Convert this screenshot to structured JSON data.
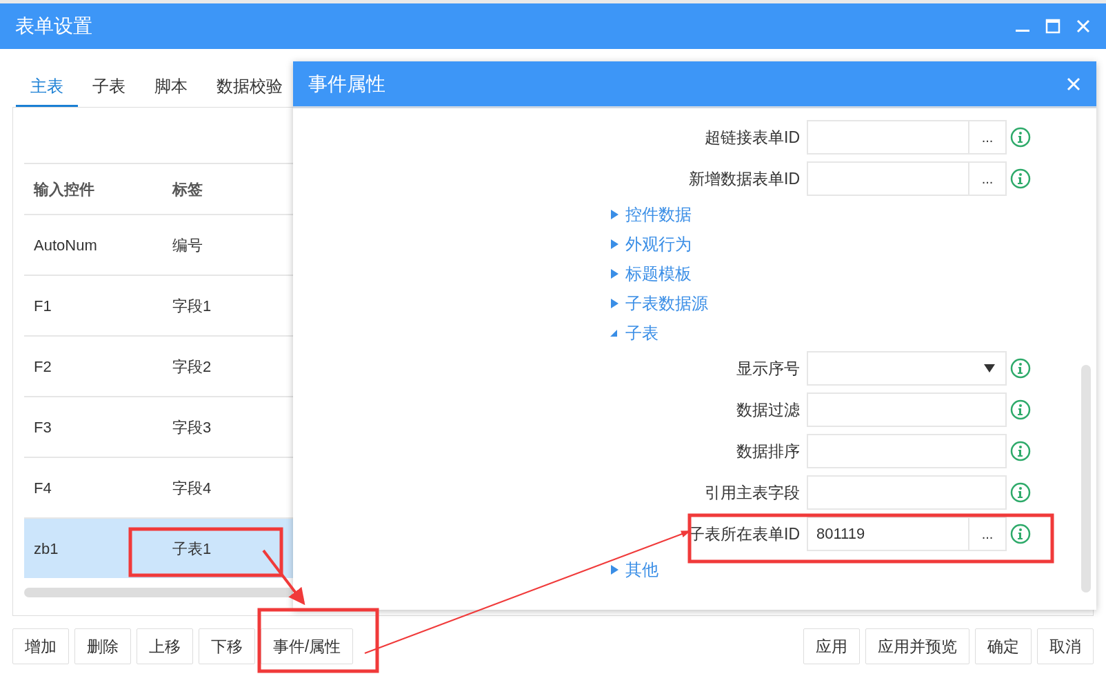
{
  "window": {
    "title": "表单设置"
  },
  "tabs": [
    {
      "label": "主表",
      "selected": true
    },
    {
      "label": "子表",
      "selected": false
    },
    {
      "label": "脚本",
      "selected": false
    },
    {
      "label": "数据校验",
      "selected": false
    }
  ],
  "table": {
    "columns": [
      "输入控件",
      "标签"
    ],
    "rows": [
      {
        "cells": [
          "AutoNum",
          "编号"
        ],
        "selected": false
      },
      {
        "cells": [
          "F1",
          "字段1"
        ],
        "selected": false
      },
      {
        "cells": [
          "F2",
          "字段2"
        ],
        "selected": false
      },
      {
        "cells": [
          "F3",
          "字段3"
        ],
        "selected": false
      },
      {
        "cells": [
          "F4",
          "字段4"
        ],
        "selected": false
      },
      {
        "cells": [
          "zb1",
          "子表1"
        ],
        "selected": true
      }
    ]
  },
  "buttons_left": [
    "增加",
    "删除",
    "上移",
    "下移",
    "事件/属性"
  ],
  "buttons_right": [
    "应用",
    "应用并预览",
    "确定",
    "取消"
  ],
  "panel": {
    "title": "事件属性",
    "items": [
      {
        "kind": "field",
        "label": "超链接表单ID",
        "button": "..."
      },
      {
        "kind": "field",
        "label": "新增数据表单ID",
        "button": "..."
      },
      {
        "kind": "section",
        "label": "控件数据",
        "expanded": false
      },
      {
        "kind": "section",
        "label": "外观行为",
        "expanded": false
      },
      {
        "kind": "section",
        "label": "标题模板",
        "expanded": false
      },
      {
        "kind": "section",
        "label": "子表数据源",
        "expanded": false
      },
      {
        "kind": "section",
        "label": "子表",
        "expanded": true
      },
      {
        "kind": "select",
        "label": "显示序号"
      },
      {
        "kind": "field",
        "label": "数据过滤"
      },
      {
        "kind": "field",
        "label": "数据排序"
      },
      {
        "kind": "field",
        "label": "引用主表字段"
      },
      {
        "kind": "field",
        "label": "子表所在表单ID",
        "value": "801119",
        "button": "..."
      },
      {
        "kind": "section",
        "label": "其他",
        "expanded": false
      }
    ]
  }
}
